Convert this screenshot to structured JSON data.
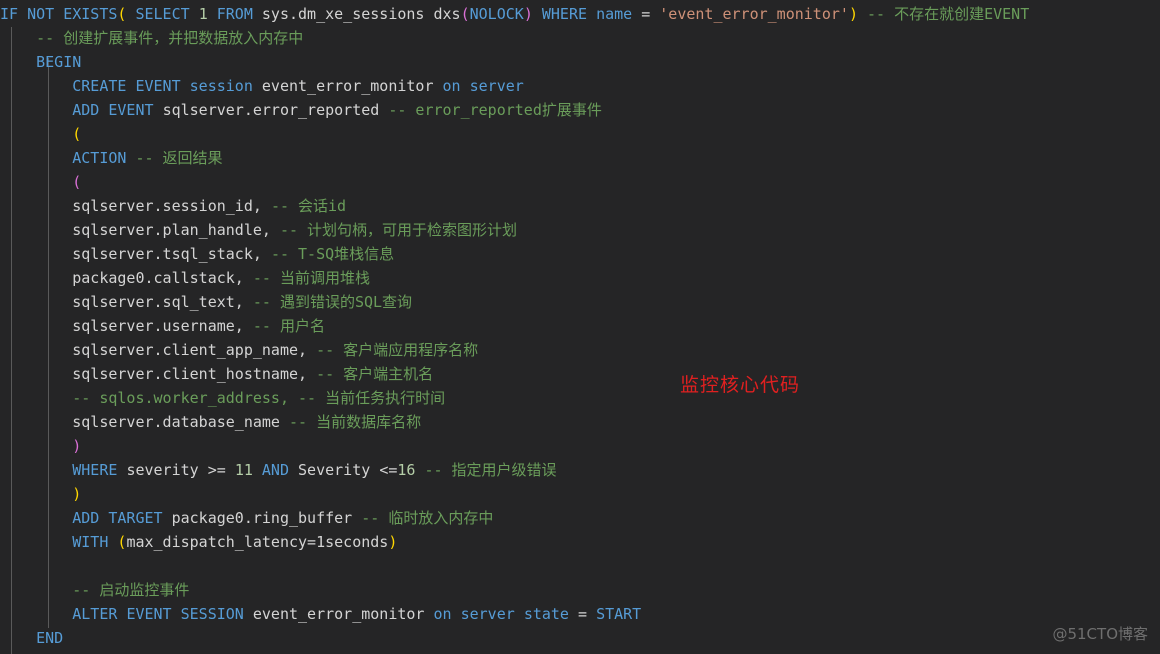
{
  "editor": {
    "background_color": "#252526",
    "indent_guide_color": "#5a5a5a",
    "palette": {
      "keyword": "#569cd6",
      "identifier": "#d4d4d4",
      "comment": "#6a9d5a",
      "string": "#ce9178",
      "number": "#b5cea8",
      "paren_yellow": "#ffd700",
      "paren_magenta": "#da70d6",
      "annotation_red": "#e02020",
      "watermark_grey": "#6f6f6f"
    }
  },
  "annotation": {
    "text": "监控核心代码"
  },
  "watermark": {
    "text": "@51CTO博客"
  },
  "code": {
    "lines": [
      {
        "indent": "",
        "tokens": [
          {
            "t": "IF",
            "c": "kw"
          },
          {
            "t": " ",
            "c": "id"
          },
          {
            "t": "NOT",
            "c": "kw"
          },
          {
            "t": " ",
            "c": "id"
          },
          {
            "t": "EXISTS",
            "c": "kw"
          },
          {
            "t": "(",
            "c": "py"
          },
          {
            "t": " ",
            "c": "id"
          },
          {
            "t": "SELECT",
            "c": "kw"
          },
          {
            "t": " ",
            "c": "id"
          },
          {
            "t": "1",
            "c": "num"
          },
          {
            "t": " ",
            "c": "id"
          },
          {
            "t": "FROM",
            "c": "kw"
          },
          {
            "t": " ",
            "c": "id"
          },
          {
            "t": "sys.dm_xe_sessions dxs",
            "c": "id"
          },
          {
            "t": "(",
            "c": "pm"
          },
          {
            "t": "NOLOCK",
            "c": "kw"
          },
          {
            "t": ")",
            "c": "pm"
          },
          {
            "t": " ",
            "c": "id"
          },
          {
            "t": "WHERE",
            "c": "kw"
          },
          {
            "t": " ",
            "c": "id"
          },
          {
            "t": "name",
            "c": "kw"
          },
          {
            "t": " ",
            "c": "id"
          },
          {
            "t": "=",
            "c": "op"
          },
          {
            "t": " ",
            "c": "id"
          },
          {
            "t": "'event_error_monitor'",
            "c": "str"
          },
          {
            "t": ")",
            "c": "py"
          },
          {
            "t": " ",
            "c": "id"
          },
          {
            "t": "-- 不存在就创建EVENT",
            "c": "cm"
          }
        ]
      },
      {
        "indent": "    ",
        "tokens": [
          {
            "t": "-- 创建扩展事件，并把数据放入内存中",
            "c": "cm"
          }
        ]
      },
      {
        "indent": "    ",
        "tokens": [
          {
            "t": "BEGIN",
            "c": "kw"
          }
        ]
      },
      {
        "indent": "        ",
        "tokens": [
          {
            "t": "CREATE",
            "c": "kw"
          },
          {
            "t": " ",
            "c": "id"
          },
          {
            "t": "EVENT",
            "c": "kw"
          },
          {
            "t": " ",
            "c": "id"
          },
          {
            "t": "session",
            "c": "kw"
          },
          {
            "t": " ",
            "c": "id"
          },
          {
            "t": "event_error_monitor",
            "c": "id"
          },
          {
            "t": " ",
            "c": "id"
          },
          {
            "t": "on",
            "c": "kw"
          },
          {
            "t": " ",
            "c": "id"
          },
          {
            "t": "server",
            "c": "kw"
          }
        ]
      },
      {
        "indent": "        ",
        "tokens": [
          {
            "t": "ADD",
            "c": "kw"
          },
          {
            "t": " ",
            "c": "id"
          },
          {
            "t": "EVENT",
            "c": "kw"
          },
          {
            "t": " ",
            "c": "id"
          },
          {
            "t": "sqlserver.error_reported",
            "c": "id"
          },
          {
            "t": " ",
            "c": "id"
          },
          {
            "t": "-- error_reported扩展事件",
            "c": "cm"
          }
        ]
      },
      {
        "indent": "        ",
        "tokens": [
          {
            "t": "(",
            "c": "py"
          }
        ]
      },
      {
        "indent": "        ",
        "tokens": [
          {
            "t": "ACTION",
            "c": "kw"
          },
          {
            "t": " ",
            "c": "id"
          },
          {
            "t": "-- 返回结果",
            "c": "cm"
          }
        ]
      },
      {
        "indent": "        ",
        "tokens": [
          {
            "t": "(",
            "c": "pm"
          }
        ]
      },
      {
        "indent": "        ",
        "tokens": [
          {
            "t": "sqlserver.session_id,",
            "c": "id"
          },
          {
            "t": " ",
            "c": "id"
          },
          {
            "t": "-- 会话id",
            "c": "cm"
          }
        ]
      },
      {
        "indent": "        ",
        "tokens": [
          {
            "t": "sqlserver.plan_handle,",
            "c": "id"
          },
          {
            "t": " ",
            "c": "id"
          },
          {
            "t": "-- 计划句柄，可用于检索图形计划",
            "c": "cm"
          }
        ]
      },
      {
        "indent": "        ",
        "tokens": [
          {
            "t": "sqlserver.tsql_stack,",
            "c": "id"
          },
          {
            "t": " ",
            "c": "id"
          },
          {
            "t": "-- T-SQ堆栈信息",
            "c": "cm"
          }
        ]
      },
      {
        "indent": "        ",
        "tokens": [
          {
            "t": "package0.callstack,",
            "c": "id"
          },
          {
            "t": " ",
            "c": "id"
          },
          {
            "t": "-- 当前调用堆栈",
            "c": "cm"
          }
        ]
      },
      {
        "indent": "        ",
        "tokens": [
          {
            "t": "sqlserver.sql_text,",
            "c": "id"
          },
          {
            "t": " ",
            "c": "id"
          },
          {
            "t": "-- 遇到错误的SQL查询",
            "c": "cm"
          }
        ]
      },
      {
        "indent": "        ",
        "tokens": [
          {
            "t": "sqlserver.username,",
            "c": "id"
          },
          {
            "t": " ",
            "c": "id"
          },
          {
            "t": "-- 用户名",
            "c": "cm"
          }
        ]
      },
      {
        "indent": "        ",
        "tokens": [
          {
            "t": "sqlserver.client_app_name,",
            "c": "id"
          },
          {
            "t": " ",
            "c": "id"
          },
          {
            "t": "-- 客户端应用程序名称",
            "c": "cm"
          }
        ]
      },
      {
        "indent": "        ",
        "tokens": [
          {
            "t": "sqlserver.client_hostname,",
            "c": "id"
          },
          {
            "t": " ",
            "c": "id"
          },
          {
            "t": "-- 客户端主机名",
            "c": "cm"
          }
        ]
      },
      {
        "indent": "        ",
        "tokens": [
          {
            "t": "-- sqlos.worker_address, -- 当前任务执行时间",
            "c": "cm"
          }
        ]
      },
      {
        "indent": "        ",
        "tokens": [
          {
            "t": "sqlserver.database_name",
            "c": "id"
          },
          {
            "t": " ",
            "c": "id"
          },
          {
            "t": "-- 当前数据库名称",
            "c": "cm"
          }
        ]
      },
      {
        "indent": "        ",
        "tokens": [
          {
            "t": ")",
            "c": "pm"
          }
        ]
      },
      {
        "indent": "        ",
        "tokens": [
          {
            "t": "WHERE",
            "c": "kw"
          },
          {
            "t": " ",
            "c": "id"
          },
          {
            "t": "severity",
            "c": "id"
          },
          {
            "t": " ",
            "c": "id"
          },
          {
            "t": ">=",
            "c": "op"
          },
          {
            "t": " ",
            "c": "id"
          },
          {
            "t": "11",
            "c": "num"
          },
          {
            "t": " ",
            "c": "id"
          },
          {
            "t": "AND",
            "c": "kw"
          },
          {
            "t": " ",
            "c": "id"
          },
          {
            "t": "Severity",
            "c": "id"
          },
          {
            "t": " ",
            "c": "id"
          },
          {
            "t": "<=",
            "c": "op"
          },
          {
            "t": "16",
            "c": "num"
          },
          {
            "t": " ",
            "c": "id"
          },
          {
            "t": "-- 指定用户级错误",
            "c": "cm"
          }
        ]
      },
      {
        "indent": "        ",
        "tokens": [
          {
            "t": ")",
            "c": "py"
          }
        ]
      },
      {
        "indent": "        ",
        "tokens": [
          {
            "t": "ADD",
            "c": "kw"
          },
          {
            "t": " ",
            "c": "id"
          },
          {
            "t": "TARGET",
            "c": "kw"
          },
          {
            "t": " ",
            "c": "id"
          },
          {
            "t": "package0.ring_buffer",
            "c": "id"
          },
          {
            "t": " ",
            "c": "id"
          },
          {
            "t": "-- 临时放入内存中",
            "c": "cm"
          }
        ]
      },
      {
        "indent": "        ",
        "tokens": [
          {
            "t": "WITH",
            "c": "kw"
          },
          {
            "t": " ",
            "c": "id"
          },
          {
            "t": "(",
            "c": "py"
          },
          {
            "t": "max_dispatch_latency=1seconds",
            "c": "id"
          },
          {
            "t": ")",
            "c": "py"
          }
        ]
      },
      {
        "indent": "",
        "tokens": []
      },
      {
        "indent": "        ",
        "tokens": [
          {
            "t": "-- 启动监控事件",
            "c": "cm"
          }
        ]
      },
      {
        "indent": "        ",
        "tokens": [
          {
            "t": "ALTER",
            "c": "kw"
          },
          {
            "t": " ",
            "c": "id"
          },
          {
            "t": "EVENT",
            "c": "kw"
          },
          {
            "t": " ",
            "c": "id"
          },
          {
            "t": "SESSION",
            "c": "kw"
          },
          {
            "t": " ",
            "c": "id"
          },
          {
            "t": "event_error_monitor",
            "c": "id"
          },
          {
            "t": " ",
            "c": "id"
          },
          {
            "t": "on",
            "c": "kw"
          },
          {
            "t": " ",
            "c": "id"
          },
          {
            "t": "server",
            "c": "kw"
          },
          {
            "t": " ",
            "c": "id"
          },
          {
            "t": "state",
            "c": "kw"
          },
          {
            "t": " ",
            "c": "id"
          },
          {
            "t": "=",
            "c": "op"
          },
          {
            "t": " ",
            "c": "id"
          },
          {
            "t": "START",
            "c": "kw"
          }
        ]
      },
      {
        "indent": "    ",
        "tokens": [
          {
            "t": "END",
            "c": "kw"
          }
        ]
      }
    ]
  }
}
